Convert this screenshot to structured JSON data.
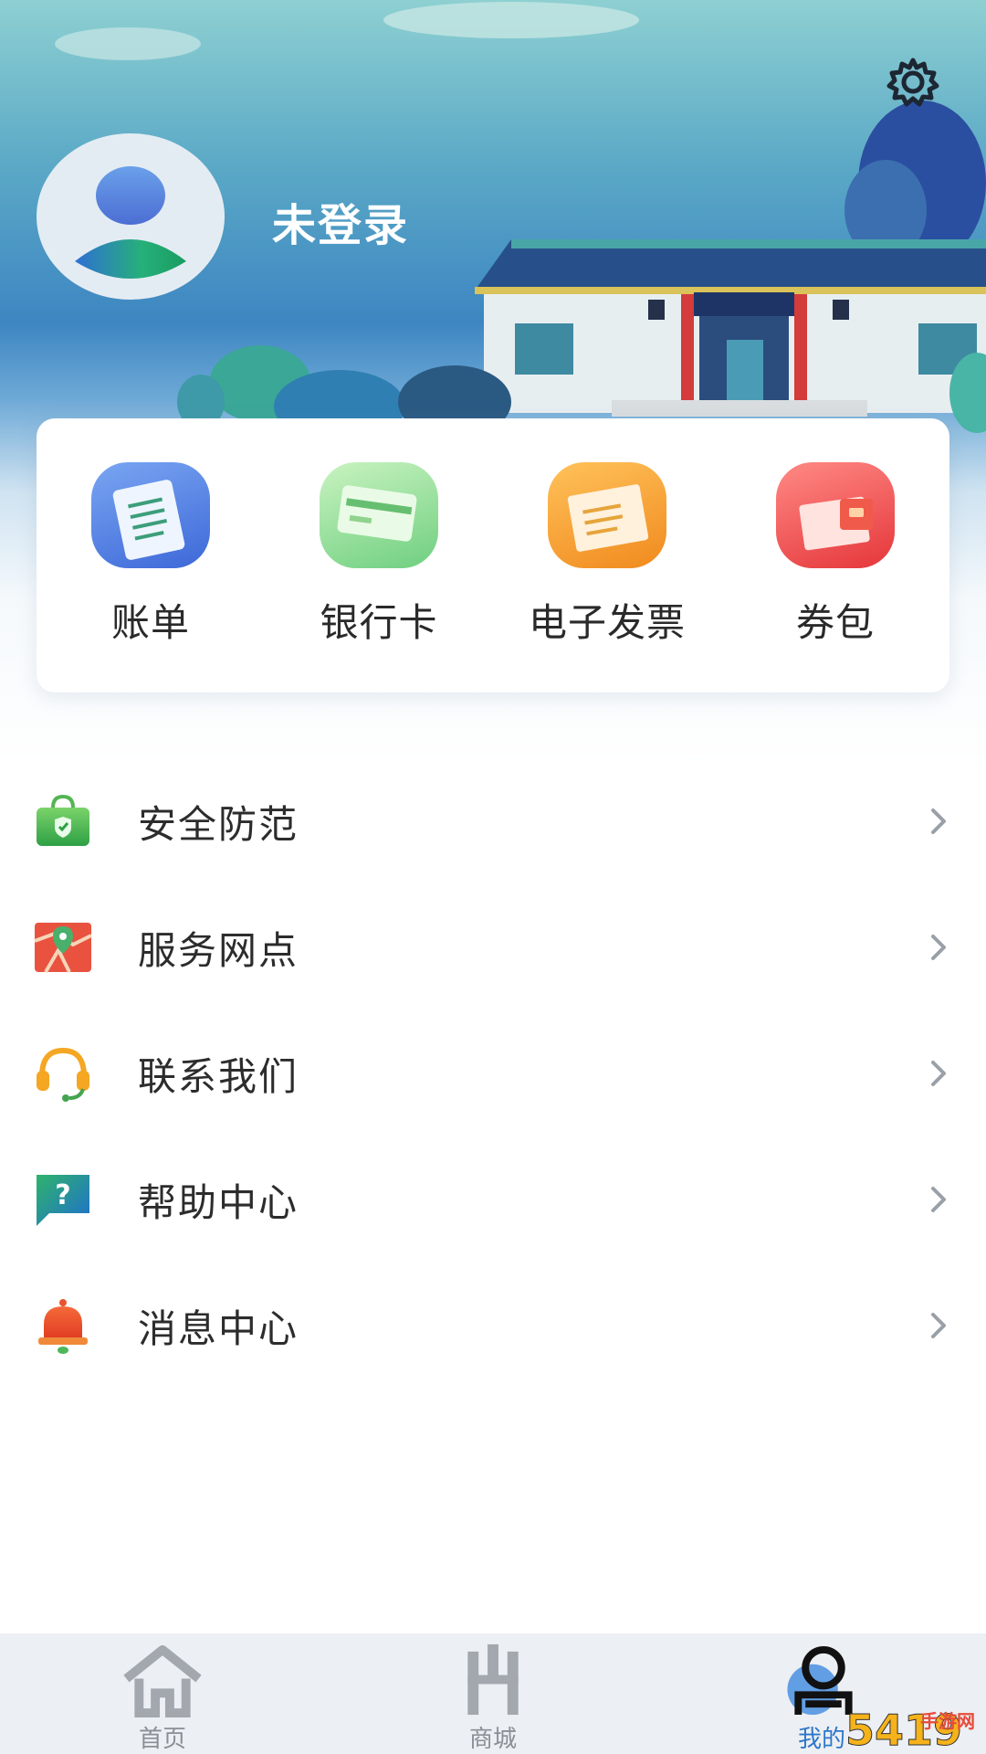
{
  "header": {
    "user_name": "未登录"
  },
  "quick_actions": [
    {
      "label": "账单",
      "icon": "bill-icon"
    },
    {
      "label": "银行卡",
      "icon": "bank-card-icon"
    },
    {
      "label": "电子发票",
      "icon": "e-invoice-icon"
    },
    {
      "label": "券包",
      "icon": "coupon-wallet-icon"
    }
  ],
  "menu": [
    {
      "label": "安全防范",
      "icon": "shield-bag-icon"
    },
    {
      "label": "服务网点",
      "icon": "map-pin-icon"
    },
    {
      "label": "联系我们",
      "icon": "headset-icon"
    },
    {
      "label": "帮助中心",
      "icon": "help-question-icon"
    },
    {
      "label": "消息中心",
      "icon": "bell-icon"
    }
  ],
  "tabbar": {
    "tabs": [
      {
        "label": "首页",
        "icon": "home-icon",
        "active": false
      },
      {
        "label": "商城",
        "icon": "mall-icon",
        "active": false
      },
      {
        "label": "我的",
        "icon": "profile-icon",
        "active": true
      }
    ]
  },
  "watermark": {
    "text": "手游网"
  },
  "colors": {
    "accent": "#2d77c9",
    "tab_bar_bg": "#eceff3"
  }
}
